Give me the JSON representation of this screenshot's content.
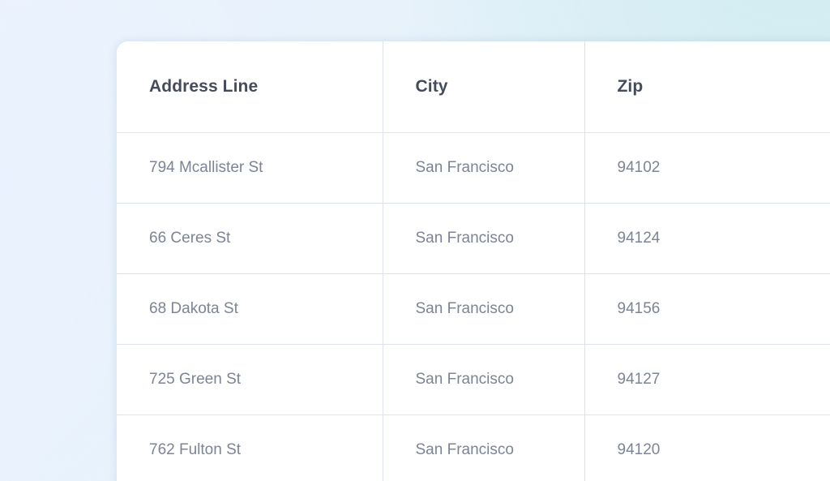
{
  "table": {
    "columns": [
      {
        "key": "address",
        "label": "Address Line"
      },
      {
        "key": "city",
        "label": "City"
      },
      {
        "key": "zip",
        "label": "Zip"
      }
    ],
    "rows": [
      {
        "address": "794 Mcallister St",
        "city": "San Francisco",
        "zip": "94102"
      },
      {
        "address": "66 Ceres St",
        "city": "San Francisco",
        "zip": "94124"
      },
      {
        "address": "68 Dakota St",
        "city": "San Francisco",
        "zip": "94156"
      },
      {
        "address": "725 Green St",
        "city": "San Francisco",
        "zip": "94127"
      },
      {
        "address": "762 Fulton St",
        "city": "San Francisco",
        "zip": "94120"
      }
    ]
  },
  "colors": {
    "header_text": "#454b5e",
    "cell_text": "#7b8499",
    "border": "#dde2ef",
    "card_background": "#ffffff",
    "page_gradient_from": "#ecf3fd",
    "page_gradient_to": "#d7edf2"
  }
}
